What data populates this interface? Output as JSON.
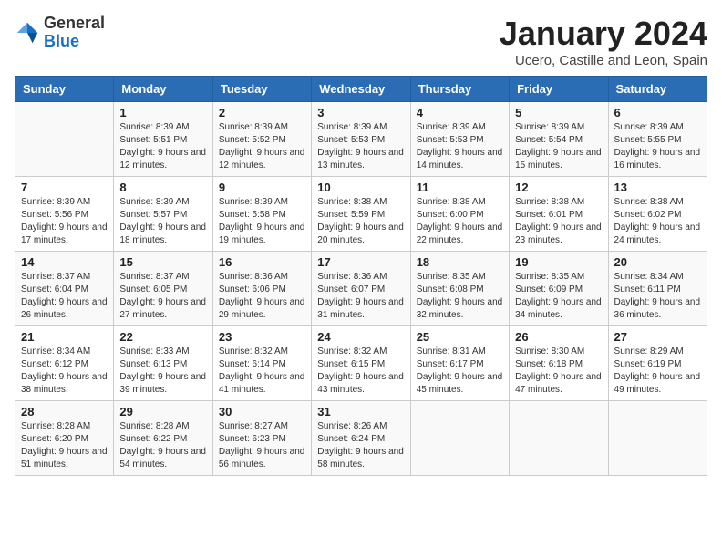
{
  "logo": {
    "general": "General",
    "blue": "Blue"
  },
  "header": {
    "title": "January 2024",
    "subtitle": "Ucero, Castille and Leon, Spain"
  },
  "weekdays": [
    "Sunday",
    "Monday",
    "Tuesday",
    "Wednesday",
    "Thursday",
    "Friday",
    "Saturday"
  ],
  "weeks": [
    [
      {
        "day": "",
        "sunrise": "",
        "sunset": "",
        "daylight": ""
      },
      {
        "day": "1",
        "sunrise": "Sunrise: 8:39 AM",
        "sunset": "Sunset: 5:51 PM",
        "daylight": "Daylight: 9 hours and 12 minutes."
      },
      {
        "day": "2",
        "sunrise": "Sunrise: 8:39 AM",
        "sunset": "Sunset: 5:52 PM",
        "daylight": "Daylight: 9 hours and 12 minutes."
      },
      {
        "day": "3",
        "sunrise": "Sunrise: 8:39 AM",
        "sunset": "Sunset: 5:53 PM",
        "daylight": "Daylight: 9 hours and 13 minutes."
      },
      {
        "day": "4",
        "sunrise": "Sunrise: 8:39 AM",
        "sunset": "Sunset: 5:53 PM",
        "daylight": "Daylight: 9 hours and 14 minutes."
      },
      {
        "day": "5",
        "sunrise": "Sunrise: 8:39 AM",
        "sunset": "Sunset: 5:54 PM",
        "daylight": "Daylight: 9 hours and 15 minutes."
      },
      {
        "day": "6",
        "sunrise": "Sunrise: 8:39 AM",
        "sunset": "Sunset: 5:55 PM",
        "daylight": "Daylight: 9 hours and 16 minutes."
      }
    ],
    [
      {
        "day": "7",
        "sunrise": "Sunrise: 8:39 AM",
        "sunset": "Sunset: 5:56 PM",
        "daylight": "Daylight: 9 hours and 17 minutes."
      },
      {
        "day": "8",
        "sunrise": "Sunrise: 8:39 AM",
        "sunset": "Sunset: 5:57 PM",
        "daylight": "Daylight: 9 hours and 18 minutes."
      },
      {
        "day": "9",
        "sunrise": "Sunrise: 8:39 AM",
        "sunset": "Sunset: 5:58 PM",
        "daylight": "Daylight: 9 hours and 19 minutes."
      },
      {
        "day": "10",
        "sunrise": "Sunrise: 8:38 AM",
        "sunset": "Sunset: 5:59 PM",
        "daylight": "Daylight: 9 hours and 20 minutes."
      },
      {
        "day": "11",
        "sunrise": "Sunrise: 8:38 AM",
        "sunset": "Sunset: 6:00 PM",
        "daylight": "Daylight: 9 hours and 22 minutes."
      },
      {
        "day": "12",
        "sunrise": "Sunrise: 8:38 AM",
        "sunset": "Sunset: 6:01 PM",
        "daylight": "Daylight: 9 hours and 23 minutes."
      },
      {
        "day": "13",
        "sunrise": "Sunrise: 8:38 AM",
        "sunset": "Sunset: 6:02 PM",
        "daylight": "Daylight: 9 hours and 24 minutes."
      }
    ],
    [
      {
        "day": "14",
        "sunrise": "Sunrise: 8:37 AM",
        "sunset": "Sunset: 6:04 PM",
        "daylight": "Daylight: 9 hours and 26 minutes."
      },
      {
        "day": "15",
        "sunrise": "Sunrise: 8:37 AM",
        "sunset": "Sunset: 6:05 PM",
        "daylight": "Daylight: 9 hours and 27 minutes."
      },
      {
        "day": "16",
        "sunrise": "Sunrise: 8:36 AM",
        "sunset": "Sunset: 6:06 PM",
        "daylight": "Daylight: 9 hours and 29 minutes."
      },
      {
        "day": "17",
        "sunrise": "Sunrise: 8:36 AM",
        "sunset": "Sunset: 6:07 PM",
        "daylight": "Daylight: 9 hours and 31 minutes."
      },
      {
        "day": "18",
        "sunrise": "Sunrise: 8:35 AM",
        "sunset": "Sunset: 6:08 PM",
        "daylight": "Daylight: 9 hours and 32 minutes."
      },
      {
        "day": "19",
        "sunrise": "Sunrise: 8:35 AM",
        "sunset": "Sunset: 6:09 PM",
        "daylight": "Daylight: 9 hours and 34 minutes."
      },
      {
        "day": "20",
        "sunrise": "Sunrise: 8:34 AM",
        "sunset": "Sunset: 6:11 PM",
        "daylight": "Daylight: 9 hours and 36 minutes."
      }
    ],
    [
      {
        "day": "21",
        "sunrise": "Sunrise: 8:34 AM",
        "sunset": "Sunset: 6:12 PM",
        "daylight": "Daylight: 9 hours and 38 minutes."
      },
      {
        "day": "22",
        "sunrise": "Sunrise: 8:33 AM",
        "sunset": "Sunset: 6:13 PM",
        "daylight": "Daylight: 9 hours and 39 minutes."
      },
      {
        "day": "23",
        "sunrise": "Sunrise: 8:32 AM",
        "sunset": "Sunset: 6:14 PM",
        "daylight": "Daylight: 9 hours and 41 minutes."
      },
      {
        "day": "24",
        "sunrise": "Sunrise: 8:32 AM",
        "sunset": "Sunset: 6:15 PM",
        "daylight": "Daylight: 9 hours and 43 minutes."
      },
      {
        "day": "25",
        "sunrise": "Sunrise: 8:31 AM",
        "sunset": "Sunset: 6:17 PM",
        "daylight": "Daylight: 9 hours and 45 minutes."
      },
      {
        "day": "26",
        "sunrise": "Sunrise: 8:30 AM",
        "sunset": "Sunset: 6:18 PM",
        "daylight": "Daylight: 9 hours and 47 minutes."
      },
      {
        "day": "27",
        "sunrise": "Sunrise: 8:29 AM",
        "sunset": "Sunset: 6:19 PM",
        "daylight": "Daylight: 9 hours and 49 minutes."
      }
    ],
    [
      {
        "day": "28",
        "sunrise": "Sunrise: 8:28 AM",
        "sunset": "Sunset: 6:20 PM",
        "daylight": "Daylight: 9 hours and 51 minutes."
      },
      {
        "day": "29",
        "sunrise": "Sunrise: 8:28 AM",
        "sunset": "Sunset: 6:22 PM",
        "daylight": "Daylight: 9 hours and 54 minutes."
      },
      {
        "day": "30",
        "sunrise": "Sunrise: 8:27 AM",
        "sunset": "Sunset: 6:23 PM",
        "daylight": "Daylight: 9 hours and 56 minutes."
      },
      {
        "day": "31",
        "sunrise": "Sunrise: 8:26 AM",
        "sunset": "Sunset: 6:24 PM",
        "daylight": "Daylight: 9 hours and 58 minutes."
      },
      {
        "day": "",
        "sunrise": "",
        "sunset": "",
        "daylight": ""
      },
      {
        "day": "",
        "sunrise": "",
        "sunset": "",
        "daylight": ""
      },
      {
        "day": "",
        "sunrise": "",
        "sunset": "",
        "daylight": ""
      }
    ]
  ]
}
